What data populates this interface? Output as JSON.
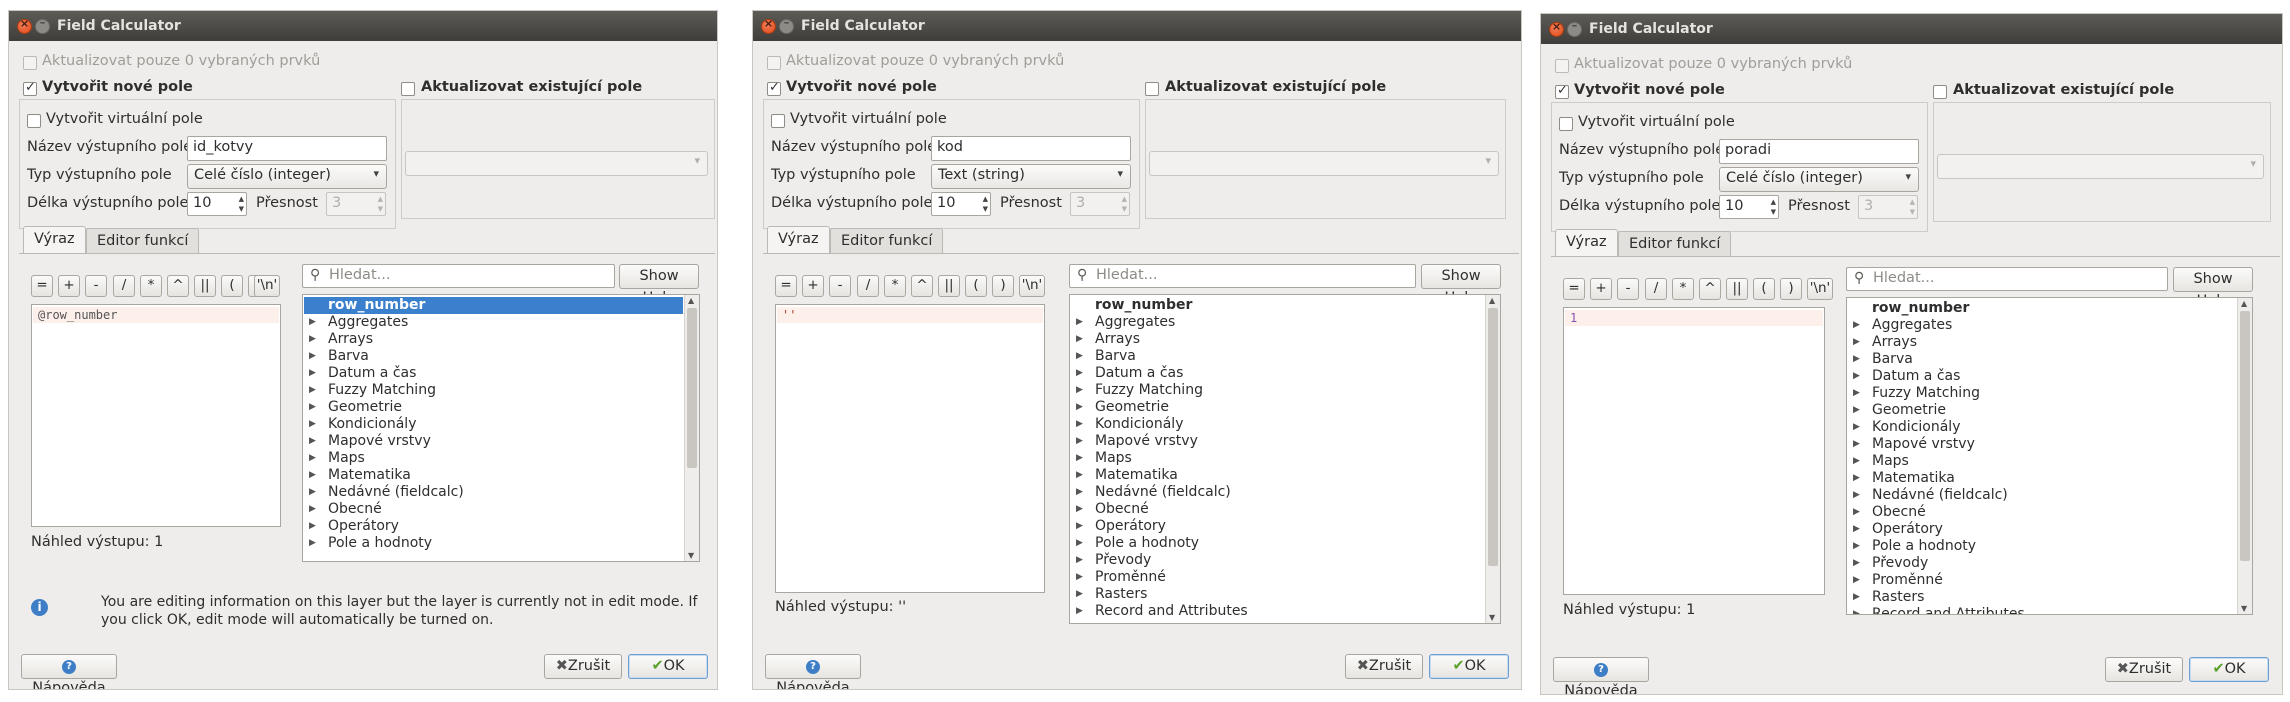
{
  "title": "Field Calculator",
  "common": {
    "update_selected": "Aktualizovat pouze 0 vybraných prvků",
    "create_new_field": "Vytvořit nové pole",
    "update_existing": "Aktualizovat existující pole",
    "create_virtual": "Vytvořit virtuální pole",
    "name_label": "Název výstupního pole",
    "type_label": "Typ výstupního pole",
    "length_label": "Délka výstupního pole",
    "precision_label": "Přesnost",
    "precision_value": "3",
    "tab_expression": "Výraz",
    "tab_function_editor": "Editor funkcí",
    "operators": [
      "=",
      "+",
      "-",
      "/",
      "*",
      "^",
      "||",
      "(",
      ")",
      "'\\n'"
    ],
    "search_placeholder": "Hledat...",
    "show_help": "Show Help",
    "help_button": "Nápověda",
    "cancel_button": "Zrušit",
    "ok_button": "OK"
  },
  "dialogs": [
    {
      "field_name": "id_kotvy",
      "field_type": "Celé číslo (integer)",
      "length": "10",
      "expression": "@row_number",
      "preview": "Náhled výstupu: 1",
      "info_message": [
        "You are editing information on this layer but the layer is currently not in edit mode. If",
        "you click OK, edit mode will automatically be turned on."
      ],
      "tree_items": [
        "row_number",
        "Aggregates",
        "Arrays",
        "Barva",
        "Datum a čas",
        "Fuzzy Matching",
        "Geometrie",
        "Kondicionály",
        "Mapové vrstvy",
        "Maps",
        "Matematika",
        "Nedávné (fieldcalc)",
        "Obecné",
        "Operátory",
        "Pole a hodnoty"
      ]
    },
    {
      "field_name": "kod",
      "field_type": "Text (string)",
      "length": "10",
      "expression": "''",
      "preview": "Náhled výstupu: ''",
      "tree_items": [
        "row_number",
        "Aggregates",
        "Arrays",
        "Barva",
        "Datum a čas",
        "Fuzzy Matching",
        "Geometrie",
        "Kondicionály",
        "Mapové vrstvy",
        "Maps",
        "Matematika",
        "Nedávné (fieldcalc)",
        "Obecné",
        "Operátory",
        "Pole a hodnoty",
        "Převody",
        "Proměnné",
        "Rasters",
        "Record and Attributes"
      ]
    },
    {
      "field_name": "poradi",
      "field_type": "Celé číslo (integer)",
      "length": "10",
      "expression": "1",
      "preview": "Náhled výstupu: 1",
      "tree_items": [
        "row_number",
        "Aggregates",
        "Arrays",
        "Barva",
        "Datum a čas",
        "Fuzzy Matching",
        "Geometrie",
        "Kondicionály",
        "Mapové vrstvy",
        "Maps",
        "Matematika",
        "Nedávné (fieldcalc)",
        "Obecné",
        "Operátory",
        "Pole a hodnoty",
        "Převody",
        "Proměnné",
        "Rasters",
        "Record and Attributes"
      ]
    }
  ]
}
